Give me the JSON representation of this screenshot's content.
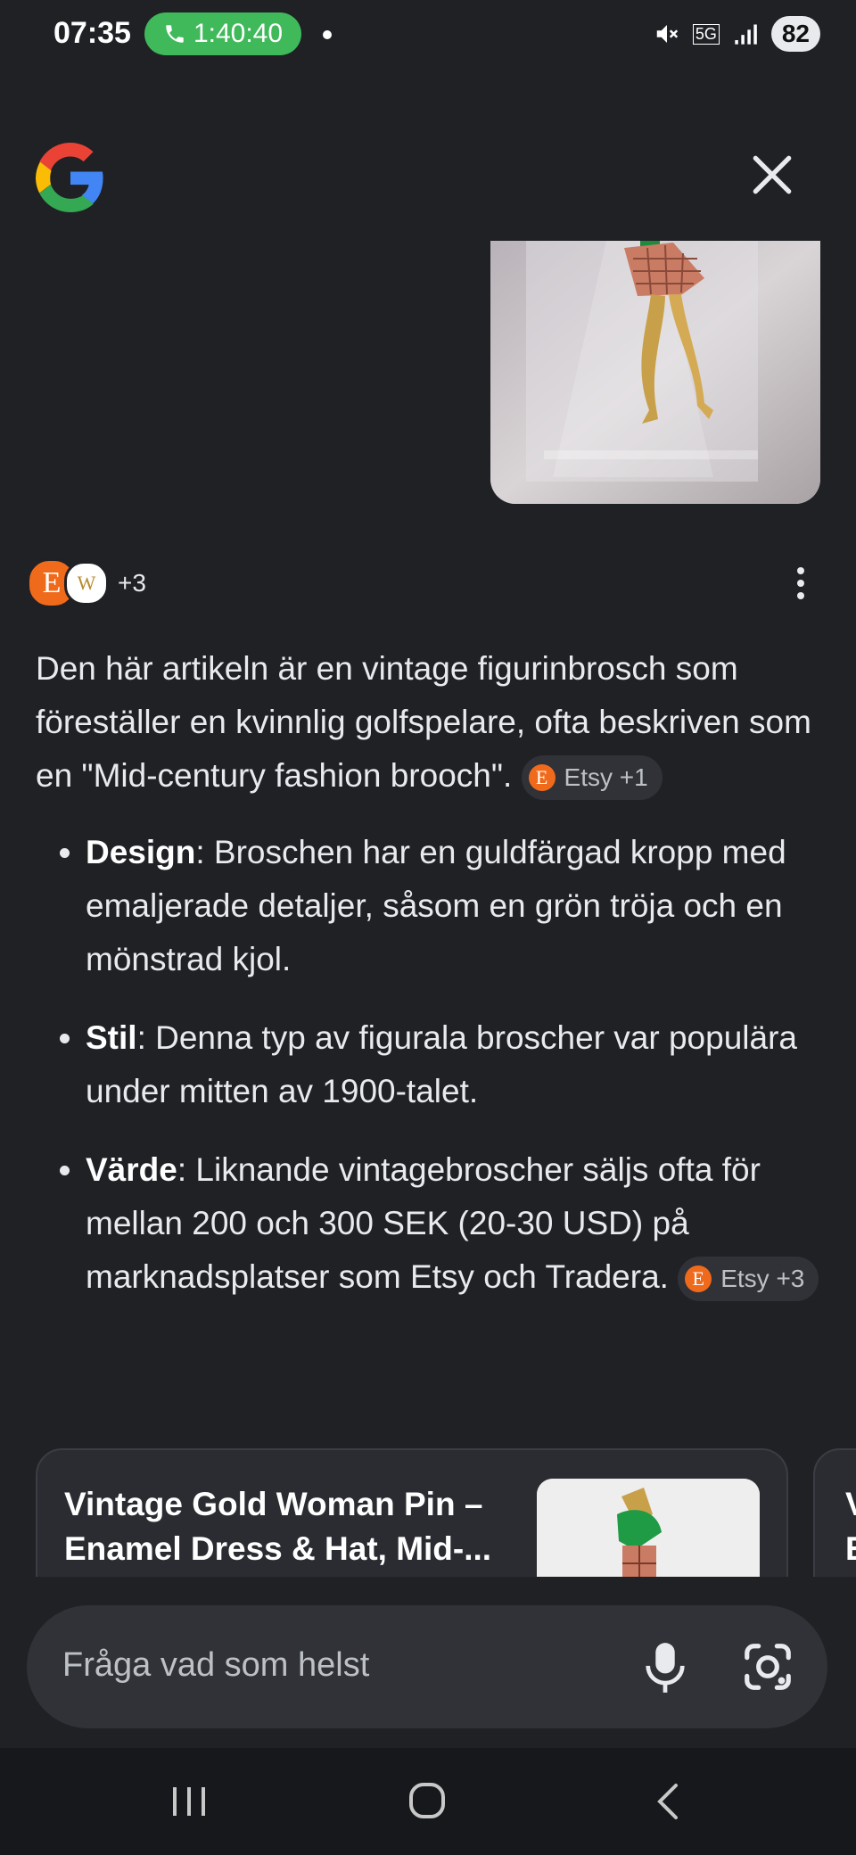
{
  "status_bar": {
    "time": "07:35",
    "call_timer": "1:40:40",
    "battery": "82",
    "network": "5G"
  },
  "header": {
    "logo_icon": "google-g-icon",
    "close_icon": "close-icon"
  },
  "sources": {
    "more": "+3"
  },
  "answer": {
    "intro": "Den här artikeln är en vintage figurinbrosch som föreställer en kvinnlig golfspelare, ofta beskriven som en \"Mid-century fashion brooch\".",
    "intro_chip": "Etsy +1",
    "bullets": [
      {
        "term": "Design",
        "text": ": Broschen har en guldfärgad kropp med emaljerade detaljer, såsom en grön tröja och en mönstrad kjol."
      },
      {
        "term": "Stil",
        "text": ": Denna typ av figurala broscher var populära under mitten av 1900-talet."
      },
      {
        "term": "Värde",
        "text": ": Liknande vintagebroscher säljs ofta för mellan 200 och 300 SEK (20-30 USD) på marknadsplatser som Etsy och Tradera."
      }
    ],
    "value_chip": "Etsy +3"
  },
  "cards": [
    {
      "title": "Vintage Gold Woman Pin – Enamel Dress & Hat, Mid-..."
    },
    {
      "title_peek": "V\nE",
      "line_peek": "V"
    }
  ],
  "ask_bar": {
    "placeholder": "Fråga vad som helst"
  },
  "colors": {
    "background": "#1f2125",
    "call_green": "#3fb95a",
    "etsy_orange": "#f06a1c"
  }
}
